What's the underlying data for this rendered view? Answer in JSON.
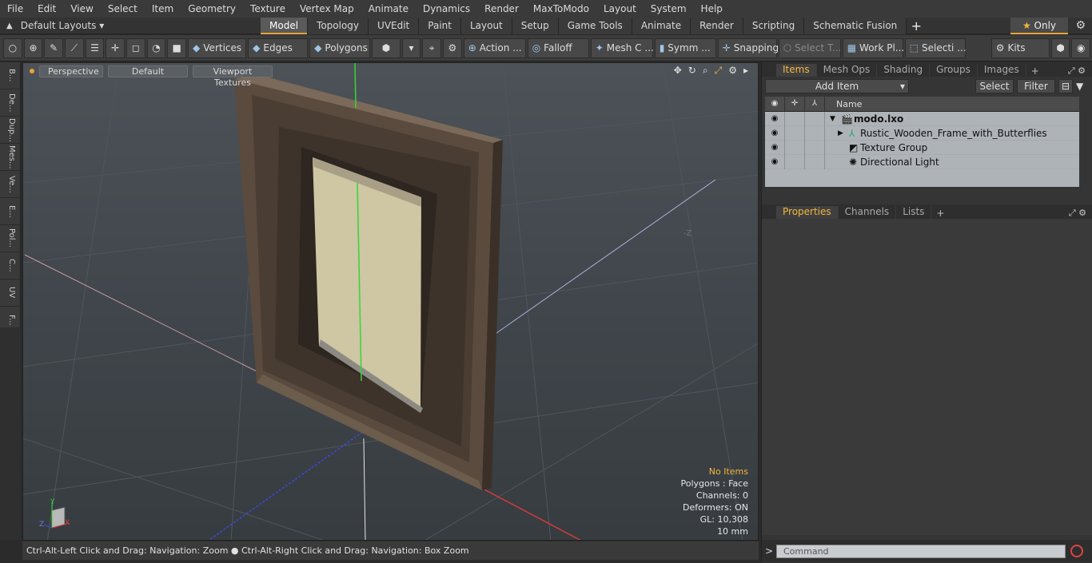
{
  "menu": [
    "File",
    "Edit",
    "View",
    "Select",
    "Item",
    "Geometry",
    "Texture",
    "Vertex Map",
    "Animate",
    "Dynamics",
    "Render",
    "MaxToModo",
    "Layout",
    "System",
    "Help"
  ],
  "layouts_label": "Default Layouts ▾",
  "tabs": [
    "Model",
    "Topology",
    "UVEdit",
    "Paint",
    "Layout",
    "Setup",
    "Game Tools",
    "Animate",
    "Render",
    "Scripting",
    "Schematic Fusion"
  ],
  "only_label": "Only",
  "toolbar": {
    "vertices": "Vertices",
    "edges": "Edges",
    "polygons": "Polygons",
    "action": "Action ...",
    "falloff": "Falloff",
    "mesh": "Mesh C ...",
    "symm": "Symm ...",
    "snapping": "Snapping",
    "select_t": "Select T...",
    "work_pl": "Work Pl...",
    "selecti": "Selecti ...",
    "kits": "Kits"
  },
  "left_tabs": [
    "B...",
    "De...",
    "Dup...",
    "Mes...",
    "Ve...",
    "E...",
    "Pol...",
    "C...",
    "UV",
    "F..."
  ],
  "viewport": {
    "perspective": "Perspective",
    "default": "Default",
    "textures": "Viewport Textures",
    "axis_label": "-Z",
    "info": {
      "no_items": "No Items",
      "polygons": "Polygons : Face",
      "channels": "Channels: 0",
      "deformers": "Deformers: ON",
      "gl": "GL: 10,308",
      "units": "10 mm"
    }
  },
  "status": "Ctrl-Alt-Left Click and Drag: Navigation: Zoom ● Ctrl-Alt-Right Click and Drag: Navigation: Box Zoom",
  "right_tabs_top": [
    "Items",
    "Mesh Ops",
    "Shading",
    "Groups",
    "Images"
  ],
  "add_item": "Add Item",
  "select_btn": "Select",
  "filter_btn": "Filter",
  "tree_header": "Name",
  "tree_rows": [
    "modo.lxo",
    "Rustic_Wooden_Frame_with_Butterflies",
    "Texture Group",
    "Directional Light"
  ],
  "right_tabs_bottom": [
    "Properties",
    "Channels",
    "Lists"
  ],
  "command_placeholder": "Command"
}
